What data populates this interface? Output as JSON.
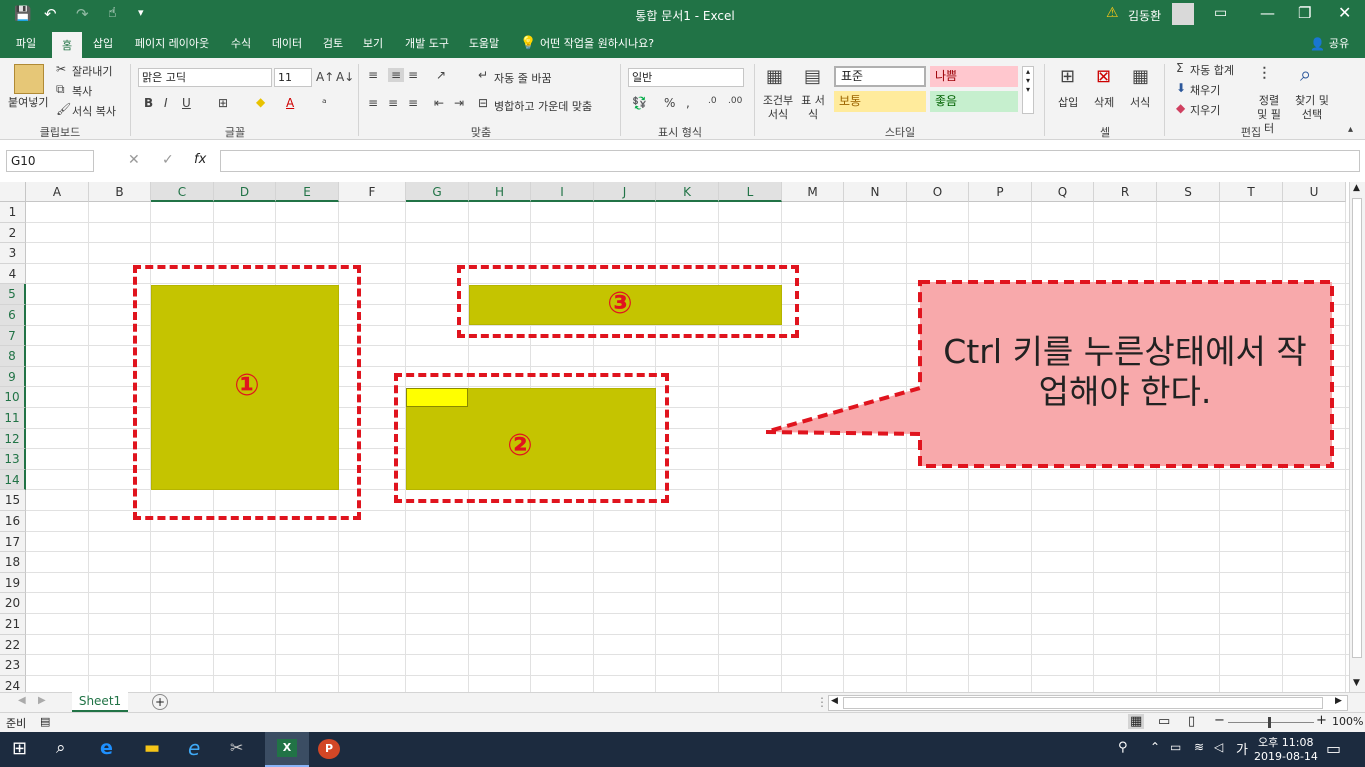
{
  "titlebar": {
    "title": "통합 문서1 - Excel",
    "user": "김동환",
    "qat_more": "▾"
  },
  "menu": {
    "tabs": [
      "파일",
      "홈",
      "삽입",
      "페이지 레이아웃",
      "수식",
      "데이터",
      "검토",
      "보기",
      "개발 도구",
      "도움말"
    ],
    "tell_me": "어떤 작업을 원하시나요?",
    "share": "공유"
  },
  "ribbon": {
    "clipboard": {
      "paste": "붙여넣기",
      "cut": "잘라내기",
      "copy": "복사",
      "format_painter": "서식 복사",
      "label": "클립보드"
    },
    "font": {
      "name": "맑은 고딕",
      "size": "11",
      "label": "글꼴"
    },
    "alignment": {
      "wrap": "자동 줄 바꿈",
      "merge": "병합하고 가운데 맞춤",
      "label": "맞춤"
    },
    "number": {
      "format": "일반",
      "label": "표시 형식"
    },
    "styles": {
      "conditional": "조건부 서식",
      "table": "표 서식",
      "normal": "표준",
      "bad": "나쁨",
      "neutral": "보통",
      "good": "좋음",
      "label": "스타일"
    },
    "cells": {
      "insert": "삽입",
      "delete": "삭제",
      "format": "서식",
      "label": "셀"
    },
    "editing": {
      "autosum": "자동 합계",
      "fill": "채우기",
      "clear": "지우기",
      "sort": "정렬 및 필터",
      "find": "찾기 및 선택",
      "label": "편집"
    }
  },
  "formula_bar": {
    "name_box": "G10",
    "fx": "fx",
    "value": ""
  },
  "grid": {
    "columns": [
      "A",
      "B",
      "C",
      "D",
      "E",
      "F",
      "G",
      "H",
      "I",
      "J",
      "K",
      "L",
      "M",
      "N",
      "O",
      "P",
      "Q",
      "R",
      "S",
      "T",
      "U"
    ],
    "rows": [
      "1",
      "2",
      "3",
      "4",
      "5",
      "6",
      "7",
      "8",
      "9",
      "10",
      "11",
      "12",
      "13",
      "14",
      "15",
      "16",
      "17",
      "18",
      "19",
      "20",
      "21",
      "22",
      "23",
      "24"
    ]
  },
  "annotations": {
    "n1": "①",
    "n2": "②",
    "n3": "③",
    "callout": "Ctrl 키를 누른상태에서 작업해야 한다."
  },
  "sheet": {
    "tab": "Sheet1"
  },
  "status": {
    "ready": "준비",
    "zoom": "100%"
  },
  "taskbar": {
    "time": "오후 11:08",
    "date": "2019-08-14",
    "ime": "가"
  },
  "colors": {
    "accent": "#217346",
    "selection": "#c5c400",
    "active_cell": "#ffff00",
    "annotation": "#e0141e",
    "callout_fill": "#f8a9ab"
  }
}
